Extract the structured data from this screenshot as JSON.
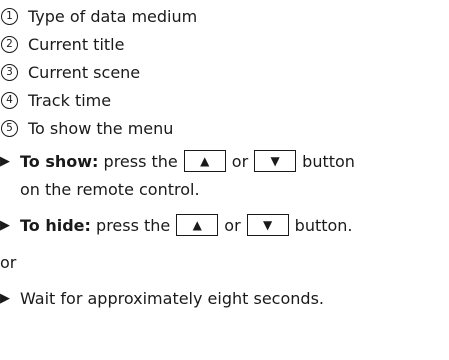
{
  "legend": [
    {
      "number": "1",
      "text": "Type of data medium"
    },
    {
      "number": "2",
      "text": "Current title"
    },
    {
      "number": "3",
      "text": "Current scene"
    },
    {
      "number": "4",
      "text": "Track time"
    },
    {
      "number": "5",
      "text": "To show the menu"
    }
  ],
  "instructions": {
    "show": {
      "label": "To show:",
      "text_before": "press the",
      "up_key": "▲",
      "or": "or",
      "down_key": "▼",
      "text_after": "button",
      "continuation": "on the remote control."
    },
    "hide": {
      "label": "To hide:",
      "text_before": "press the",
      "up_key": "▲",
      "or": "or",
      "down_key": "▼",
      "text_after": "button."
    },
    "or_word": "or",
    "wait": "Wait for approximately eight seconds."
  },
  "icons": {
    "bullet": "triangle-right-icon"
  }
}
